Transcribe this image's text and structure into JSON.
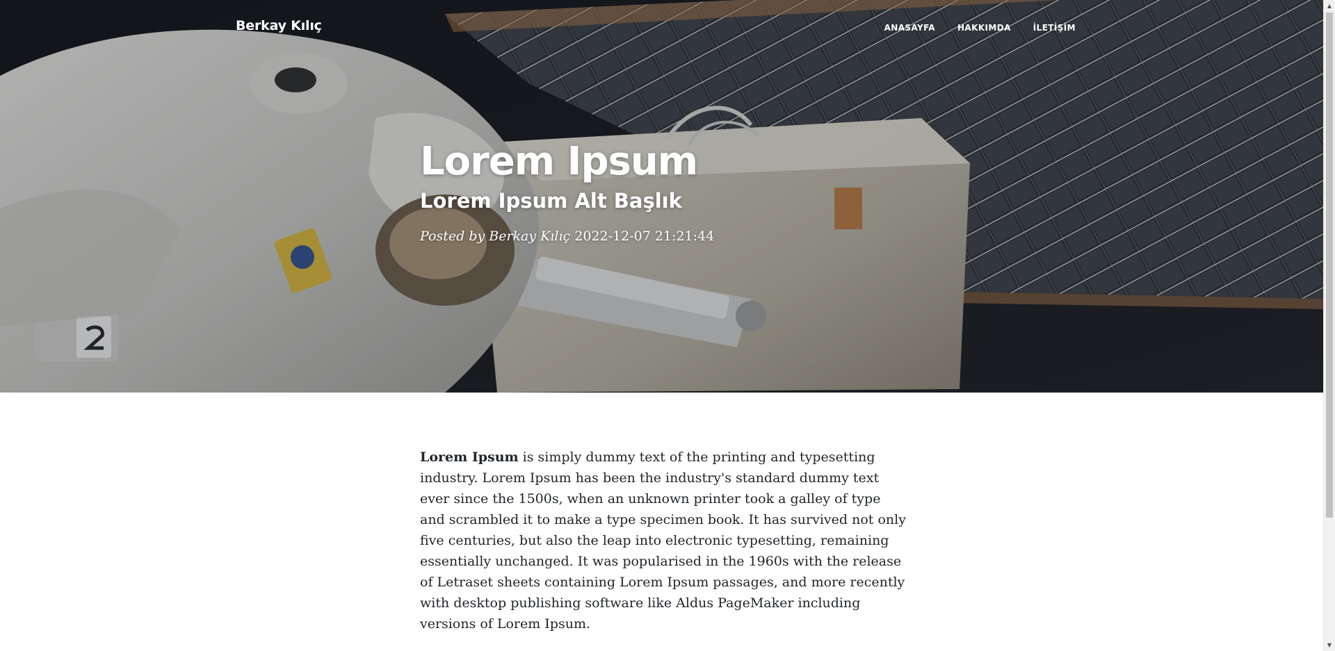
{
  "navbar": {
    "brand": "Berkay Kılıç",
    "links": [
      {
        "label": "ANASAYFA"
      },
      {
        "label": "HAKKIMDA"
      },
      {
        "label": "İLETİŞİM"
      }
    ]
  },
  "post": {
    "title": "Lorem Ipsum",
    "subtitle": "Lorem Ipsum Alt Başlık",
    "meta_prefix": "Posted by",
    "author": "Berkay Kılıç",
    "date": "2022-12-07 21:21:44"
  },
  "article": {
    "lead": "Lorem Ipsum",
    "body": " is simply dummy text of the printing and typesetting industry. Lorem Ipsum has been the industry's standard dummy text ever since the 1500s, when an unknown printer took a galley of type and scrambled it to make a type specimen book. It has survived not only five centuries, but also the leap into electronic typesetting, remaining essentially unchanged. It was popularised in the 1960s with the release of Letraset sheets containing Lorem Ipsum passages, and more recently with desktop publishing software like Aldus PageMaker including versions of Lorem Ipsum."
  },
  "hero_image": {
    "subject": "astronaut-spacewalk-with-solar-array",
    "overlay_color": "#212529"
  },
  "colors": {
    "text_dark": "#212529",
    "text_light": "#ffffff"
  }
}
